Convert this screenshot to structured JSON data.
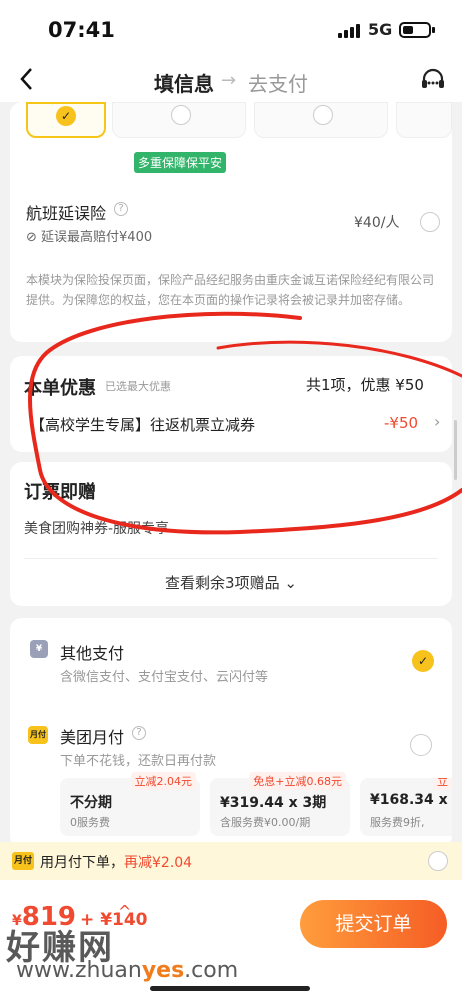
{
  "status_bar": {
    "time": "07:41",
    "network": "5G"
  },
  "nav": {
    "back_icon": "chevron-left-icon",
    "step_current": "填信息",
    "step_arrow": "→",
    "step_next": "去支付",
    "service_icon": "headset-icon"
  },
  "insurance": {
    "badge": "多重保障保平安",
    "delay_name": "航班延误险",
    "delay_desc": "延误最高赔付¥400",
    "delay_price": "¥40/人",
    "note": "本模块为保险投保页面，保险产品经纪服务由重庆金诚互诺保险经纪有限公司提供。为保障您的权益，您在本页面的操作记录将会被记录并加密存储。"
  },
  "discount": {
    "title": "本单优惠",
    "selected_hint": "已选最大优惠",
    "summary": "共1项，优惠 ¥50",
    "coupon_label": "【高校学生专属】往返机票立减券",
    "coupon_amount": "-¥50"
  },
  "gifts": {
    "title": "订票即赠",
    "item": "美食团购神券-服服专享",
    "more": "查看剩余3项赠品"
  },
  "payment": {
    "other": {
      "icon_text": "¥",
      "label": "其他支付",
      "desc": "含微信支付、支付宝支付、云闪付等"
    },
    "monthly": {
      "icon_text": "月付",
      "label": "美团月付",
      "desc": "下单不花钱，还款日再付款"
    },
    "plans": [
      {
        "tag": "立减2.04元",
        "title": "不分期",
        "sub": "0服务费"
      },
      {
        "tag": "免息+立减0.68元",
        "title": "¥319.44 x 3期",
        "sub": "含服务费¥0.00/期"
      },
      {
        "tag": "立",
        "title": "¥168.34 x",
        "sub": "服务费9折,"
      }
    ]
  },
  "promo": {
    "icon_text": "月付",
    "text": "用月付下单，",
    "highlight": "再减¥2.04"
  },
  "bottom": {
    "currency": "¥",
    "price": "819",
    "extra": "+ ¥140",
    "caret": "^",
    "submit": "提交订单",
    "watermark": "好赚网",
    "watermark_url_a": "www.zhuan",
    "watermark_url_b": "yes",
    "watermark_url_c": ".com"
  },
  "colors": {
    "accent": "#f04a30",
    "yellow": "#f7c21c",
    "green": "#32b46b",
    "annotation": "#e8281c"
  }
}
